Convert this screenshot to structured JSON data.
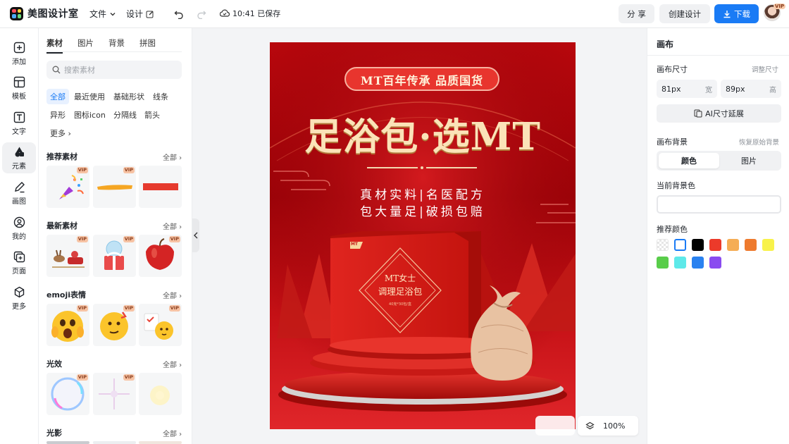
{
  "app": {
    "name": "美图设计室"
  },
  "topbar": {
    "file_label": "文件",
    "design_label": "设计",
    "save_status": "10:41 已保存",
    "share_label": "分 享",
    "create_label": "创建设计",
    "download_label": "下载",
    "vip_badge": "VIP"
  },
  "rail": {
    "items": [
      {
        "label": "添加",
        "icon": "plus-square-icon"
      },
      {
        "label": "模板",
        "icon": "template-icon"
      },
      {
        "label": "文字",
        "icon": "text-icon"
      },
      {
        "label": "元素",
        "icon": "shapes-icon"
      },
      {
        "label": "画图",
        "icon": "pen-icon"
      },
      {
        "label": "我的",
        "icon": "user-icon"
      },
      {
        "label": "页面",
        "icon": "add-page-icon"
      },
      {
        "label": "更多",
        "icon": "cube-icon"
      }
    ],
    "active": "元素"
  },
  "panel": {
    "tabs": [
      "素材",
      "图片",
      "背景",
      "拼图"
    ],
    "active_tab": "素材",
    "search_placeholder": "搜索素材",
    "chips": [
      "全部",
      "最近使用",
      "基础形状",
      "线条",
      "异形",
      "图标icon",
      "分隔线",
      "箭头",
      "更多"
    ],
    "active_chip": "全部",
    "sections": [
      {
        "title": "推荐素材",
        "all": "全部"
      },
      {
        "title": "最新素材",
        "all": "全部"
      },
      {
        "title": "emoji表情",
        "all": "全部"
      },
      {
        "title": "光效",
        "all": "全部"
      },
      {
        "title": "光影",
        "all": "全部"
      }
    ],
    "vip_label": "VIP"
  },
  "poster": {
    "banner": "MT百年传承 品质国货",
    "headline": "足浴包·选MT",
    "line1": "真材实料|名医配方",
    "line2": "包大量足|破损包赔",
    "box_tag": "MT",
    "box_title_1": "MT女士",
    "box_title_2": "调理足浴包",
    "box_small": "40克*30包/盒"
  },
  "right": {
    "title": "画布",
    "size_label": "画布尺寸",
    "size_hint": "调整尺寸",
    "width": {
      "value": "81px",
      "unit": "宽"
    },
    "height": {
      "value": "89px",
      "unit": "高"
    },
    "ai_button": "AI尺寸延展",
    "bg_label": "画布背景",
    "bg_reset": "恢复原始背景",
    "seg_color": "颜色",
    "seg_image": "图片",
    "current_bg_label": "当前背景色",
    "recommend_label": "推荐颜色",
    "swatches": [
      "transparent",
      "#ffffff",
      "#000000",
      "#ec3a2a",
      "#f5ad55",
      "#ee7a2e",
      "#f8f24a",
      "#59cd4a",
      "#5ee9e9",
      "#2a82f0",
      "#8a4bf0"
    ]
  },
  "zoom": {
    "value": "100%"
  }
}
